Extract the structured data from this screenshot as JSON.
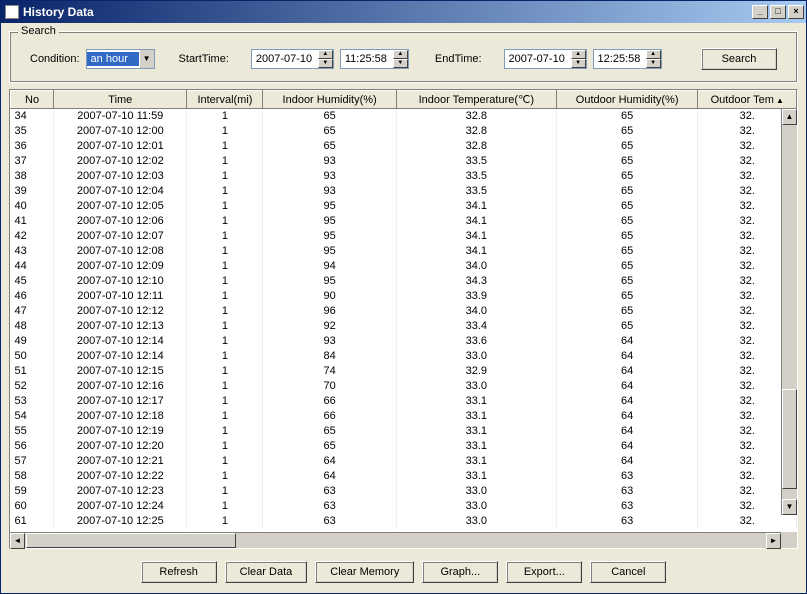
{
  "window": {
    "title": "History Data"
  },
  "search": {
    "group_label": "Search",
    "condition_label": "Condition:",
    "condition_value": "an hour",
    "starttime_label": "StartTime:",
    "start_date": "2007-07-10",
    "start_time": "11:25:58",
    "endtime_label": "EndTime:",
    "end_date": "2007-07-10",
    "end_time": "12:25:58",
    "search_btn": "Search"
  },
  "grid": {
    "columns": [
      "No",
      "Time",
      "Interval(mi)",
      "Indoor Humidity(%)",
      "Indoor Temperature(℃)",
      "Outdoor Humidity(%)",
      "Outdoor Tem"
    ],
    "sort_indicator_col": 6,
    "rows": [
      {
        "no": "34",
        "time": "2007-07-10 11:59",
        "interval": "1",
        "ih": "65",
        "it": "32.8",
        "oh": "65",
        "ot": "32."
      },
      {
        "no": "35",
        "time": "2007-07-10 12:00",
        "interval": "1",
        "ih": "65",
        "it": "32.8",
        "oh": "65",
        "ot": "32."
      },
      {
        "no": "36",
        "time": "2007-07-10 12:01",
        "interval": "1",
        "ih": "65",
        "it": "32.8",
        "oh": "65",
        "ot": "32."
      },
      {
        "no": "37",
        "time": "2007-07-10 12:02",
        "interval": "1",
        "ih": "93",
        "it": "33.5",
        "oh": "65",
        "ot": "32."
      },
      {
        "no": "38",
        "time": "2007-07-10 12:03",
        "interval": "1",
        "ih": "93",
        "it": "33.5",
        "oh": "65",
        "ot": "32."
      },
      {
        "no": "39",
        "time": "2007-07-10 12:04",
        "interval": "1",
        "ih": "93",
        "it": "33.5",
        "oh": "65",
        "ot": "32."
      },
      {
        "no": "40",
        "time": "2007-07-10 12:05",
        "interval": "1",
        "ih": "95",
        "it": "34.1",
        "oh": "65",
        "ot": "32."
      },
      {
        "no": "41",
        "time": "2007-07-10 12:06",
        "interval": "1",
        "ih": "95",
        "it": "34.1",
        "oh": "65",
        "ot": "32."
      },
      {
        "no": "42",
        "time": "2007-07-10 12:07",
        "interval": "1",
        "ih": "95",
        "it": "34.1",
        "oh": "65",
        "ot": "32."
      },
      {
        "no": "43",
        "time": "2007-07-10 12:08",
        "interval": "1",
        "ih": "95",
        "it": "34.1",
        "oh": "65",
        "ot": "32."
      },
      {
        "no": "44",
        "time": "2007-07-10 12:09",
        "interval": "1",
        "ih": "94",
        "it": "34.0",
        "oh": "65",
        "ot": "32."
      },
      {
        "no": "45",
        "time": "2007-07-10 12:10",
        "interval": "1",
        "ih": "95",
        "it": "34.3",
        "oh": "65",
        "ot": "32."
      },
      {
        "no": "46",
        "time": "2007-07-10 12:11",
        "interval": "1",
        "ih": "90",
        "it": "33.9",
        "oh": "65",
        "ot": "32."
      },
      {
        "no": "47",
        "time": "2007-07-10 12:12",
        "interval": "1",
        "ih": "96",
        "it": "34.0",
        "oh": "65",
        "ot": "32."
      },
      {
        "no": "48",
        "time": "2007-07-10 12:13",
        "interval": "1",
        "ih": "92",
        "it": "33.4",
        "oh": "65",
        "ot": "32."
      },
      {
        "no": "49",
        "time": "2007-07-10 12:14",
        "interval": "1",
        "ih": "93",
        "it": "33.6",
        "oh": "64",
        "ot": "32."
      },
      {
        "no": "50",
        "time": "2007-07-10 12:14",
        "interval": "1",
        "ih": "84",
        "it": "33.0",
        "oh": "64",
        "ot": "32."
      },
      {
        "no": "51",
        "time": "2007-07-10 12:15",
        "interval": "1",
        "ih": "74",
        "it": "32.9",
        "oh": "64",
        "ot": "32."
      },
      {
        "no": "52",
        "time": "2007-07-10 12:16",
        "interval": "1",
        "ih": "70",
        "it": "33.0",
        "oh": "64",
        "ot": "32."
      },
      {
        "no": "53",
        "time": "2007-07-10 12:17",
        "interval": "1",
        "ih": "66",
        "it": "33.1",
        "oh": "64",
        "ot": "32."
      },
      {
        "no": "54",
        "time": "2007-07-10 12:18",
        "interval": "1",
        "ih": "66",
        "it": "33.1",
        "oh": "64",
        "ot": "32."
      },
      {
        "no": "55",
        "time": "2007-07-10 12:19",
        "interval": "1",
        "ih": "65",
        "it": "33.1",
        "oh": "64",
        "ot": "32."
      },
      {
        "no": "56",
        "time": "2007-07-10 12:20",
        "interval": "1",
        "ih": "65",
        "it": "33.1",
        "oh": "64",
        "ot": "32."
      },
      {
        "no": "57",
        "time": "2007-07-10 12:21",
        "interval": "1",
        "ih": "64",
        "it": "33.1",
        "oh": "64",
        "ot": "32."
      },
      {
        "no": "58",
        "time": "2007-07-10 12:22",
        "interval": "1",
        "ih": "64",
        "it": "33.1",
        "oh": "63",
        "ot": "32."
      },
      {
        "no": "59",
        "time": "2007-07-10 12:23",
        "interval": "1",
        "ih": "63",
        "it": "33.0",
        "oh": "63",
        "ot": "32."
      },
      {
        "no": "60",
        "time": "2007-07-10 12:24",
        "interval": "1",
        "ih": "63",
        "it": "33.0",
        "oh": "63",
        "ot": "32."
      },
      {
        "no": "61",
        "time": "2007-07-10 12:25",
        "interval": "1",
        "ih": "63",
        "it": "33.0",
        "oh": "63",
        "ot": "32."
      }
    ]
  },
  "actions": {
    "refresh": "Refresh",
    "clear_data": "Clear Data",
    "clear_memory": "Clear Memory",
    "graph": "Graph...",
    "export": "Export...",
    "cancel": "Cancel"
  }
}
